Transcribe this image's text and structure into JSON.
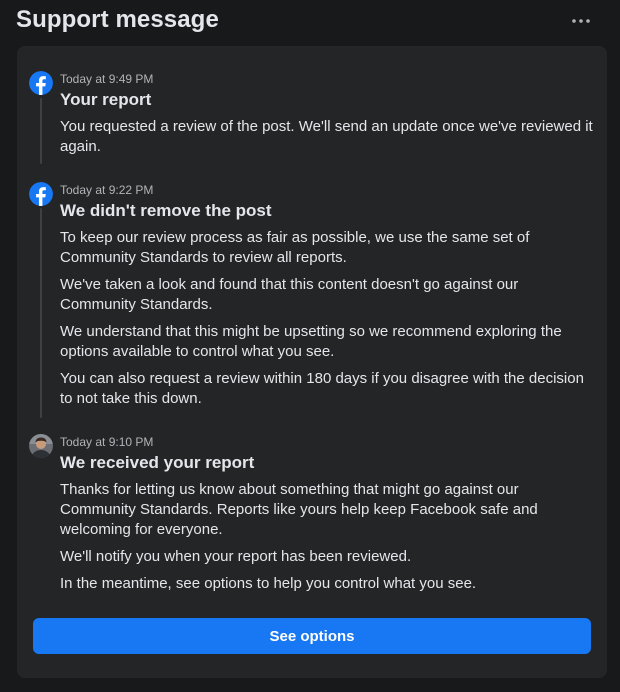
{
  "header": {
    "title": "Support message",
    "more_icon": "more-horizontal-icon"
  },
  "messages": [
    {
      "icon": "facebook-logo-icon",
      "time": "Today at 9:49 PM",
      "heading": "Your report",
      "paragraphs": [
        "You requested a review of the post. We'll send an update once we've reviewed it again."
      ]
    },
    {
      "icon": "facebook-logo-icon",
      "time": "Today at 9:22 PM",
      "heading": "We didn't remove the post",
      "paragraphs": [
        "To keep our review process as fair as possible, we use the same set of Community Standards to review all reports.",
        "We've taken a look and found that this content doesn't go against our Community Standards.",
        "We understand that this might be upsetting so we recommend exploring the options available to control what you see.",
        "You can also request a review within 180 days if you disagree with the decision to not take this down."
      ]
    },
    {
      "icon": "user-avatar-icon",
      "time": "Today at 9:10 PM",
      "heading": "We received your report",
      "paragraphs": [
        "Thanks for letting us know about something that might go against our Community Standards. Reports like yours help keep Facebook safe and welcoming for everyone.",
        "We'll notify you when your report has been reviewed.",
        "In the meantime, see options to help you control what you see."
      ]
    }
  ],
  "actions": {
    "see_options_label": "See options"
  },
  "colors": {
    "background": "#18191a",
    "card": "#242526",
    "accent": "#1877f2",
    "timeline": "#3e4042"
  }
}
